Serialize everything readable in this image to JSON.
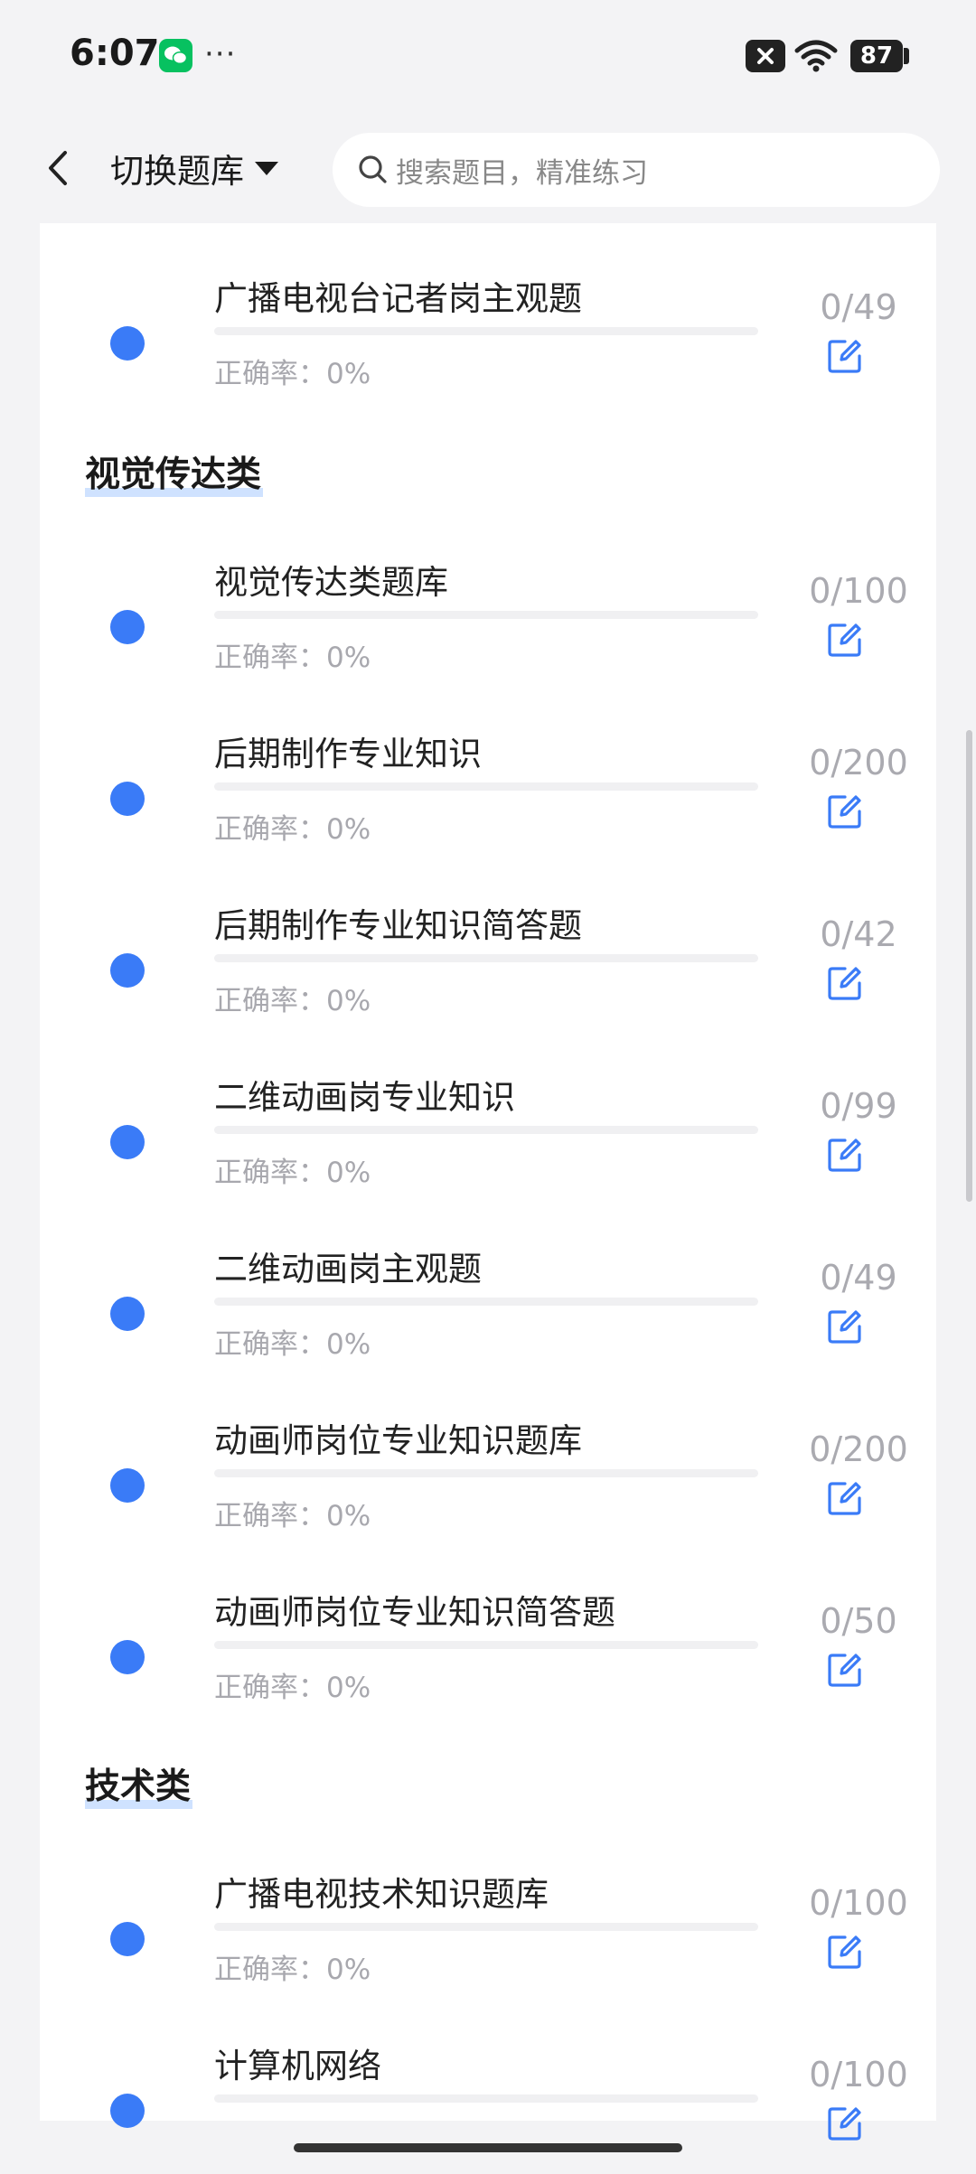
{
  "status_bar": {
    "time": "6:07",
    "more": "···",
    "battery": "87",
    "icons": [
      "wechat-icon",
      "mute-icon",
      "wifi-icon",
      "battery-icon"
    ]
  },
  "header": {
    "switch_label": "切换题库",
    "search_placeholder": "搜索题目，精准练习"
  },
  "accuracy_prefix": "正确率：",
  "colors": {
    "accent": "#3a7bf7",
    "section_highlight": "#cfe2ff",
    "muted_text": "#a8a8ae",
    "background": "#f3f3f5"
  },
  "groups": [
    {
      "title": "",
      "items": [
        {
          "title": "广播电视台记者岗主观题",
          "accuracy": "正确率：0%",
          "count": "0/49",
          "progress": 0
        }
      ]
    },
    {
      "title": "视觉传达类",
      "items": [
        {
          "title": "视觉传达类题库",
          "accuracy": "正确率：0%",
          "count": "0/100",
          "progress": 0
        },
        {
          "title": "后期制作专业知识",
          "accuracy": "正确率：0%",
          "count": "0/200",
          "progress": 0
        },
        {
          "title": "后期制作专业知识简答题",
          "accuracy": "正确率：0%",
          "count": "0/42",
          "progress": 0
        },
        {
          "title": "二维动画岗专业知识",
          "accuracy": "正确率：0%",
          "count": "0/99",
          "progress": 0
        },
        {
          "title": "二维动画岗主观题",
          "accuracy": "正确率：0%",
          "count": "0/49",
          "progress": 0
        },
        {
          "title": "动画师岗位专业知识题库",
          "accuracy": "正确率：0%",
          "count": "0/200",
          "progress": 0
        },
        {
          "title": "动画师岗位专业知识简答题",
          "accuracy": "正确率：0%",
          "count": "0/50",
          "progress": 0
        }
      ]
    },
    {
      "title": "技术类",
      "items": [
        {
          "title": "广播电视技术知识题库",
          "accuracy": "正确率：0%",
          "count": "0/100",
          "progress": 0
        },
        {
          "title": "计算机网络",
          "accuracy": "",
          "count": "0/100",
          "progress": 0
        }
      ]
    }
  ]
}
